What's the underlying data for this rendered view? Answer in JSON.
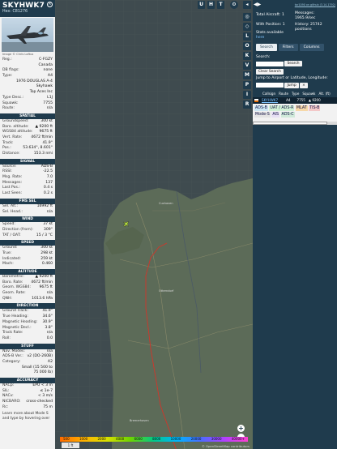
{
  "aircraft": {
    "callsign": "SKYHWK7",
    "hex": "Hex: C81276",
    "photo_credit": "Image © Chris Loftus"
  },
  "info_rows": [
    {
      "k": "Reg.:",
      "v": "C-FGZY"
    },
    {
      "k": "",
      "v": "Canada"
    },
    {
      "k": "DB flags:",
      "v": "none"
    },
    {
      "k": "Type:",
      "v": "A4"
    },
    {
      "k": "",
      "v": "1976 DOUGLAS A-4"
    },
    {
      "k": "",
      "v": "Skyhawk"
    },
    {
      "k": "",
      "v": "Top Aces Inc"
    },
    {
      "k": "Type Desc.:",
      "v": "L1J"
    },
    {
      "k": "Squawk:",
      "v": "7755"
    },
    {
      "k": "Route:",
      "v": "n/a"
    }
  ],
  "sections": {
    "spatial": "SPATIAL",
    "signal": "SIGNAL",
    "fms": "FMS SEL",
    "wind": "WIND",
    "speed": "SPEED",
    "altitude": "ALTITUDE",
    "direction": "DIRECTION",
    "stuff": "STUFF",
    "accuracy": "ACCURACY"
  },
  "spatial_rows": [
    {
      "k": "Groundspeed:",
      "v": "300 kt"
    },
    {
      "k": "Baro. altitude:",
      "v": "▲ 9200 ft"
    },
    {
      "k": "WGS84 altitude:",
      "v": "9675 ft"
    },
    {
      "k": "Vert. Rate:",
      "v": "4672 ft/min"
    },
    {
      "k": "Track:",
      "v": "41.9°"
    },
    {
      "k": "Pos.:",
      "v": "53.634°, 8.601°"
    },
    {
      "k": "Distance:",
      "v": "153.3 nmi"
    }
  ],
  "signal_rows": [
    {
      "k": "Source:",
      "v": "ADS-B"
    },
    {
      "k": "RSSI:",
      "v": "-22.5"
    },
    {
      "k": "Msg. Rate:",
      "v": "7.0"
    },
    {
      "k": "Messages:",
      "v": "137"
    },
    {
      "k": "Last Pos.:",
      "v": "0.4 s"
    },
    {
      "k": "Last Seen:",
      "v": "0.2 s"
    }
  ],
  "fms_rows": [
    {
      "k": "Sel. Alt.:",
      "v": "16992 ft"
    },
    {
      "k": "Sel. Head.:",
      "v": "n/a"
    }
  ],
  "wind_rows": [
    {
      "k": "Speed:",
      "v": "37 kt"
    },
    {
      "k": "Direction (from):",
      "v": "309°"
    },
    {
      "k": "TAT / OAT:",
      "v": "15 / 3 °C"
    }
  ],
  "speed_rows": [
    {
      "k": "Ground:",
      "v": "300 kt"
    },
    {
      "k": "True:",
      "v": "298 kt"
    },
    {
      "k": "Indicated:",
      "v": "259 kt"
    },
    {
      "k": "Mach:",
      "v": "0.460"
    }
  ],
  "altitude_rows": [
    {
      "k": "Barometric:",
      "v": "▲ 9200 ft"
    },
    {
      "k": "Baro. Rate:",
      "v": "4672 ft/min"
    },
    {
      "k": "Geom. WGS84:",
      "v": "9675 ft"
    },
    {
      "k": "Geom. Rate:",
      "v": "n/a"
    },
    {
      "k": "QNH:",
      "v": "1013.6 hPa"
    }
  ],
  "direction_rows": [
    {
      "k": "Ground Track:",
      "v": "41.9°"
    },
    {
      "k": "True Heading:",
      "v": "34.6°"
    },
    {
      "k": "Magnetic Heading:",
      "v": "30.9°"
    },
    {
      "k": "Magnetic Decl.:",
      "v": "3.8°"
    },
    {
      "k": "Track Rate:",
      "v": "n/a"
    },
    {
      "k": "Roll:",
      "v": "0.0"
    }
  ],
  "stuff_rows": [
    {
      "k": "Nav. Modes:",
      "v": "n/a"
    },
    {
      "k": "ADS-B Ver.:",
      "v": "v2 (DO-260B)"
    },
    {
      "k": "Category:",
      "v": "A2"
    },
    {
      "k": "",
      "v": "Small (15 500 to"
    },
    {
      "k": "",
      "v": "75 000 lb)"
    }
  ],
  "accuracy_rows": [
    {
      "k": "NACp:",
      "v": "EPU < 3 m"
    },
    {
      "k": "SIL:",
      "v": "≤ 1e-7"
    },
    {
      "k": "NACv:",
      "v": "< 3 m/s"
    },
    {
      "k": "NICBARO:",
      "v": "cross-checked"
    },
    {
      "k": "Rc:",
      "v": "75 m"
    }
  ],
  "footer_text": "Learn more about Mode S and type by hovering over",
  "map": {
    "top_buttons": [
      "U",
      "H",
      "T"
    ],
    "side_buttons": [
      "L",
      "O",
      "K",
      "V",
      "M",
      "P",
      "I",
      "R"
    ],
    "zoom_in": "+",
    "zoom_out": "−",
    "altitude_labels": [
      "500",
      "1000",
      "2000",
      "4000",
      "6000",
      "8000",
      "10000",
      "20000",
      "30000",
      "40000+"
    ],
    "unit_button": "1 ft",
    "attribution": "© OpenStreetMap contributors",
    "place_labels": [
      "Cuxhaven",
      "Otterndorf",
      "Bremerhaven"
    ]
  },
  "right": {
    "version": "tar1090 on github (3.14.1792)",
    "total_aircraft_label": "Total Aircraft: 1",
    "with_position_label": "With Position: 1",
    "stats_label": "Stats available",
    "stats_link": "here",
    "messages_label": "Messages:",
    "messages_value": "1965.9/sec",
    "history_label": "History: 25742",
    "history_unit": "positions",
    "tabs": [
      "Search",
      "Filters",
      "Columns"
    ],
    "search_label": "Search:",
    "search_button": "Search",
    "clear_button": "Clear Search",
    "jump_label": "Jump to Airport or Latitude, Longitude:",
    "jump_button": "Jump",
    "clear_jump_button": "×",
    "columns": [
      "Callsign",
      "Route",
      "Type",
      "Squawk",
      "Alt. (ft)"
    ],
    "row": {
      "callsign": "SKYHWK7",
      "type": "A4",
      "squawk": "7755",
      "alt": "▲ 9200"
    },
    "badges": [
      "ADS-B",
      "UAT / ADS-R",
      "MLAT",
      "TIS-B",
      "Mode-S",
      "AIS",
      "ADS-C"
    ]
  },
  "colors": {
    "panel_dark": "#1f3b4d",
    "map_water": "#3f4b4f",
    "map_land": "#5c6b58",
    "track": "#d2352a",
    "aircraft": "#b6e03a"
  }
}
